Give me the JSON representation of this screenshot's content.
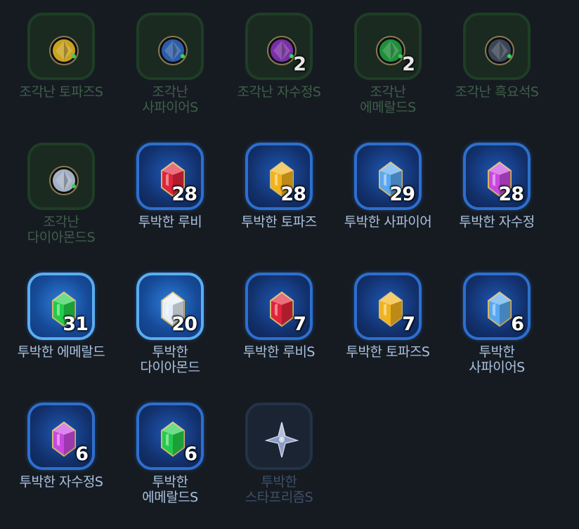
{
  "items": [
    {
      "label": "조각난 토파즈S",
      "count": "",
      "kind": "shard",
      "color": "#c9a21e"
    },
    {
      "label": "조각난\n사파이어S",
      "count": "",
      "kind": "shard",
      "color": "#2d5da8"
    },
    {
      "label": "조각난 자수정S",
      "count": "2",
      "kind": "shard",
      "color": "#7a2fa6"
    },
    {
      "label": "조각난\n에메랄드S",
      "count": "2",
      "kind": "shard",
      "color": "#1f8f3a"
    },
    {
      "label": "조각난 흑요석S",
      "count": "",
      "kind": "shard",
      "color": "#3c4656"
    },
    {
      "label": "조각난\n다이아몬드S",
      "count": "",
      "kind": "shard",
      "color": "#a5b1c2"
    },
    {
      "label": "투박한 루비",
      "count": "28",
      "kind": "gem",
      "color": "#e0243a"
    },
    {
      "label": "투박한 토파즈",
      "count": "28",
      "kind": "gem",
      "color": "#f2b21c"
    },
    {
      "label": "투박한 사파이어",
      "count": "29",
      "kind": "gem",
      "color": "#58a8f0"
    },
    {
      "label": "투박한 자수정",
      "count": "28",
      "kind": "gem",
      "color": "#c948e0"
    },
    {
      "label": "투박한 에메랄드",
      "count": "31",
      "kind": "gem",
      "color": "#22cc4a"
    },
    {
      "label": "투박한\n다이아몬드",
      "count": "20",
      "kind": "gem",
      "color": "#e6eef7"
    },
    {
      "label": "투박한 루비S",
      "count": "7",
      "kind": "gem",
      "color": "#e0243a"
    },
    {
      "label": "투박한 토파즈S",
      "count": "7",
      "kind": "gem",
      "color": "#f2b21c"
    },
    {
      "label": "투박한\n사파이어S",
      "count": "6",
      "kind": "gem",
      "color": "#58a8f0"
    },
    {
      "label": "투박한 자수정S",
      "count": "6",
      "kind": "gem",
      "color": "#c948e0"
    },
    {
      "label": "투박한\n에메랄드S",
      "count": "6",
      "kind": "gem",
      "color": "#22cc4a"
    },
    {
      "label": "투박한\n스타프리즘S",
      "count": "",
      "kind": "star",
      "color": "#8a9cc4"
    }
  ]
}
